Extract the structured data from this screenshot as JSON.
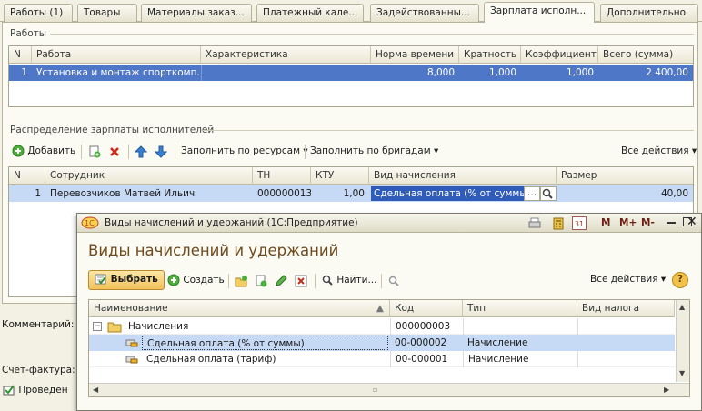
{
  "tabs": [
    {
      "label": "Работы (1)"
    },
    {
      "label": "Товары"
    },
    {
      "label": "Материалы заказ..."
    },
    {
      "label": "Платежный кале..."
    },
    {
      "label": "Задействованны..."
    },
    {
      "label": "Зарплата исполн..."
    },
    {
      "label": "Дополнительно"
    }
  ],
  "works": {
    "group_label": "Работы",
    "columns": {
      "n": "N",
      "work": "Работа",
      "char": "Характеристика",
      "norm": "Норма времени",
      "mult": "Кратность",
      "coef": "Коэффициент",
      "total": "Всего (сумма)"
    },
    "rows": [
      {
        "n": "1",
        "work": "Установка и монтаж спорткомп...",
        "char": "",
        "norm": "8,000",
        "mult": "1,000",
        "coef": "1,000",
        "total": "2 400,00"
      }
    ]
  },
  "salary": {
    "group_label": "Распределение зарплаты исполнителей",
    "toolbar": {
      "add": "Добавить",
      "fill_resources": "Заполнить по ресурсам",
      "fill_brigades": "Заполнить по бригадам",
      "all_actions": "Все действия"
    },
    "columns": {
      "n": "N",
      "employee": "Сотрудник",
      "tn": "ТН",
      "ktu": "КТУ",
      "accrual": "Вид начисления",
      "size": "Размер"
    },
    "rows": [
      {
        "n": "1",
        "employee": "Перевозчиков Матвей Ильич",
        "tn": "000000013",
        "ktu": "1,00",
        "accrual": "Сдельная оплата (% от суммы)",
        "size": "40,00"
      }
    ]
  },
  "left_labels": {
    "comment": "Комментарий:",
    "invoice": "Счет-фактура:",
    "posted": "Проведен"
  },
  "dialog": {
    "window_title": "Виды начислений и удержаний  (1С:Предприятие)",
    "heading": "Виды начислений и удержаний",
    "toolbar": {
      "select": "Выбрать",
      "create": "Создать",
      "find": "Найти...",
      "all_actions": "Все действия"
    },
    "title_buttons": {
      "m": "M",
      "m_plus": "M+",
      "m_minus": "M-"
    },
    "calendar_day": "31",
    "columns": {
      "name": "Наименование",
      "code": "Код",
      "type": "Тип",
      "tax": "Вид налога"
    },
    "rows": [
      {
        "name": "Начисления",
        "code": "000000003",
        "type": "",
        "tax": ""
      },
      {
        "name": "Сдельная оплата (% от суммы)",
        "code": "00-000002",
        "type": "Начисление",
        "tax": ""
      },
      {
        "name": "Сдельная оплата (тариф)",
        "code": "00-000001",
        "type": "Начисление",
        "tax": ""
      }
    ]
  },
  "colors": {
    "selection": "#4f77c7",
    "selection_light": "#c7daf5",
    "heading": "#6e4a1e",
    "tab_bg": "#f2f1e4"
  }
}
